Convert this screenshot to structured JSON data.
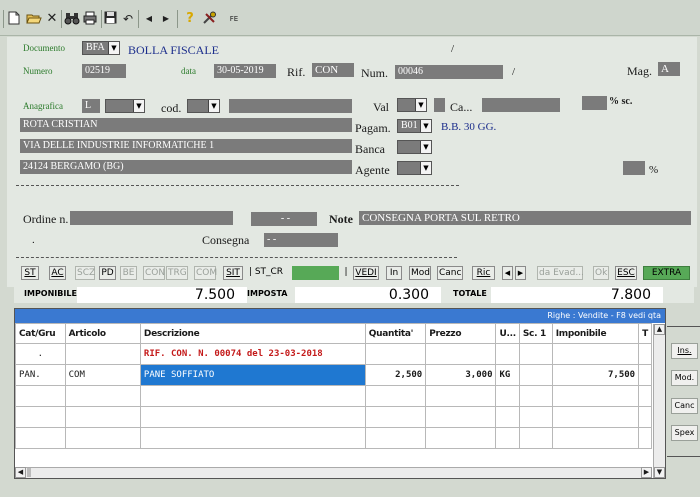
{
  "toolbar": {
    "fe_label": "FE"
  },
  "form": {
    "documento_label": "Documento",
    "documento_code": "BFA",
    "documento_desc": "BOLLA FISCALE",
    "slash1": "/",
    "numero_label": "Numero",
    "numero_value": "02519",
    "data_label": "data",
    "data_value": "30-05-2019",
    "rif_label": "Rif.",
    "rif_value": "CON",
    "num_label": "Num.",
    "num_value": "00046",
    "slash2": "/",
    "mag_label": "Mag.",
    "mag_value": "A",
    "anagrafica_label": "Anagrafica",
    "anagrafica_type": "L",
    "cod_label": "cod.",
    "val_label": "Val",
    "ca_label": "Ca...",
    "sc_label": "% sc.",
    "name_value": "ROTA CRISTIAN",
    "address_value": "VIA DELLE INDUSTRIE INFORMATICHE 1",
    "city_value": "24124 BERGAMO (BG)",
    "pagam_label": "Pagam.",
    "pagam_code": "B01",
    "pagam_desc": "B.B. 30 GG.",
    "banca_label": "Banca",
    "agente_label": "Agente",
    "agente_pct": "%",
    "ordine_label": "Ordine n.",
    "ordine_date": "- -",
    "note_label": "Note",
    "note_value": "CONSEGNA PORTA SUL RETRO",
    "dot": ".",
    "consegna_label": "Consegna",
    "consegna_value": "- -"
  },
  "actions": {
    "st": "ST",
    "ac": "AC",
    "scz": "SCZ",
    "pd": "PD",
    "be": "BE",
    "con": "CON",
    "trg": "TRG",
    "com": "COM",
    "sit": "SIT",
    "st_cr": "| ST_CR",
    "sep": "|",
    "vedi": "VEDI",
    "in": "In",
    "mod": "Mod",
    "canc": "Canc",
    "ric": "Ric",
    "da_evad": "da Evad...",
    "ok": "Ok",
    "esc": "ESC",
    "extra": "EXTRA"
  },
  "totals": {
    "imponibile_label": "IMPONIBILE",
    "imponibile_value": "7.500",
    "imposta_label": "IMPOSTA",
    "imposta_value": "0.300",
    "totale_label": "TOTALE",
    "totale_value": "7.800"
  },
  "grid": {
    "bar_title": "Righe : Vendite - F8 vedi qta",
    "headers": [
      "Cat/Gru",
      "Articolo",
      "Descrizione",
      "Quantita'",
      "Prezzo",
      "U...",
      "Sc. 1",
      "Imponibile",
      "T"
    ],
    "rows": [
      {
        "cat": ".",
        "art": "",
        "desc": "RIF. CON. N. 00074 del 23-03-2018",
        "qta": "",
        "prezzo": "",
        "um": "",
        "sc": "",
        "imp": "",
        "t": ""
      },
      {
        "cat": "PAN.",
        "art": "COM",
        "desc": "PANE SOFFIATO",
        "qta": "2,500",
        "prezzo": "3,000",
        "um": "KG",
        "sc": "",
        "imp": "7,500",
        "t": ""
      }
    ]
  },
  "side": {
    "ins": "Ins.",
    "mod": "Mod.",
    "canc": "Canc",
    "spex": "Spex"
  },
  "colors": {
    "background": "#d3d9d0",
    "field": "#7b7b7b",
    "selection": "#1f78d1",
    "extra_green": "#57a957",
    "label_green": "#2a7a2a"
  }
}
